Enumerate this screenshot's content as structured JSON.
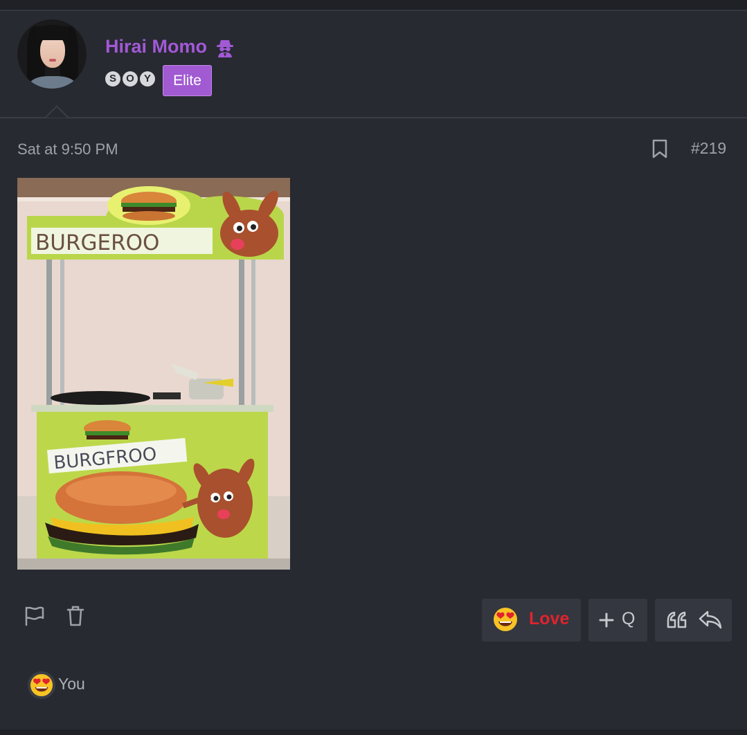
{
  "user": {
    "name": "Hirai Momo",
    "badge_letters": [
      "S",
      "O",
      "Y"
    ],
    "rank": "Elite",
    "name_color": "#a259d6",
    "rank_color": "#a15ad2",
    "status_icon": "spy-icon"
  },
  "post": {
    "timestamp": "Sat at 9:50 PM",
    "number": "#219",
    "image": {
      "description_icon": "burger-stand-photo",
      "sign_top": "BURGEROO",
      "sign_front": "BURGFROO"
    }
  },
  "actions": {
    "reaction_label": "Love",
    "multiquote_label": "Q",
    "reaction_color": "#e0232e"
  },
  "reactions": {
    "summary": "You"
  }
}
